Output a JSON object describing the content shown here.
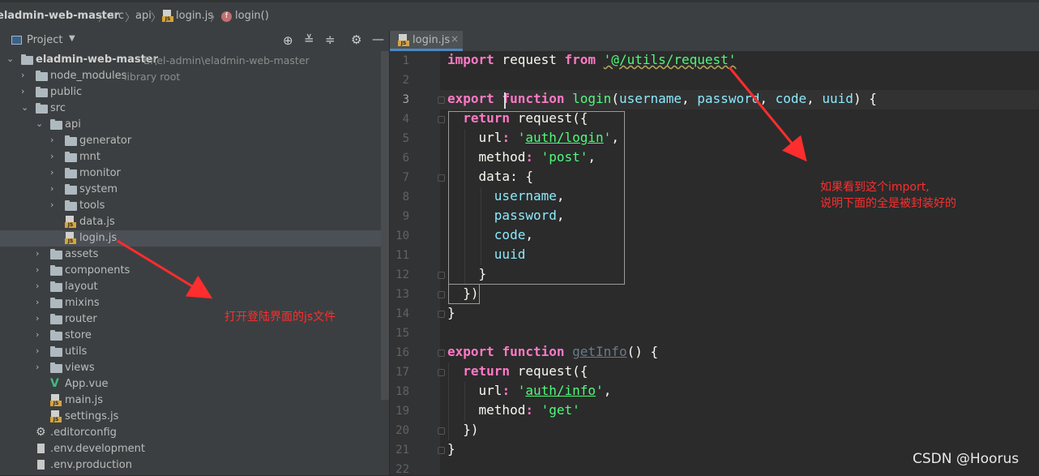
{
  "breadcrumb": {
    "project": "eladmin-web-master",
    "src": "src",
    "api": "api",
    "file": "login.js",
    "func": "login()",
    "func_badge": "f"
  },
  "project_panel": {
    "title": "Project",
    "root": {
      "name": "eladmin-web-master",
      "path": "E:\\el-admin\\eladmin-web-master"
    },
    "items": [
      {
        "label": "node_modules",
        "hint": "library root"
      },
      {
        "label": "public"
      },
      {
        "label": "src"
      },
      {
        "label": "api"
      },
      {
        "label": "generator"
      },
      {
        "label": "mnt"
      },
      {
        "label": "monitor"
      },
      {
        "label": "system"
      },
      {
        "label": "tools"
      },
      {
        "label": "data.js"
      },
      {
        "label": "login.js"
      },
      {
        "label": "assets"
      },
      {
        "label": "components"
      },
      {
        "label": "layout"
      },
      {
        "label": "mixins"
      },
      {
        "label": "router"
      },
      {
        "label": "store"
      },
      {
        "label": "utils"
      },
      {
        "label": "views"
      },
      {
        "label": "App.vue"
      },
      {
        "label": "main.js"
      },
      {
        "label": "settings.js"
      },
      {
        "label": ".editorconfig"
      },
      {
        "label": ".env.development"
      },
      {
        "label": ".env.production"
      }
    ]
  },
  "editor": {
    "tab_label": "login.js",
    "tab_close": "×",
    "line_numbers": [
      "1",
      "2",
      "3",
      "4",
      "5",
      "6",
      "7",
      "8",
      "9",
      "10",
      "11",
      "12",
      "13",
      "14",
      "15",
      "16",
      "17",
      "18",
      "19",
      "20",
      "21",
      "22"
    ],
    "code": {
      "l1_import": "import",
      "l1_request": " request ",
      "l1_from": "from",
      "l1_str": "'@/utils/request'",
      "l3_export": "export",
      "l3_function": "function",
      "l3_name": "login",
      "l3_open": "(",
      "l3_p1": "username",
      "l3_c1": ", ",
      "l3_p2": "password",
      "l3_c2": ", ",
      "l3_p3": "code",
      "l3_c3": ", ",
      "l3_p4": "uuid",
      "l3_close": ") {",
      "l4_return": "return",
      "l4_rest": " request({",
      "l5_key": "url",
      "l5_colon": ": ",
      "l5_q1": "'",
      "l5_val": "auth/login",
      "l5_q2": "'",
      "l5_end": ",",
      "l6_key": "method",
      "l6_colon": ": ",
      "l6_val": "'post'",
      "l6_end": ",",
      "l7_key": "data",
      "l7_rest": ": {",
      "l8": "username",
      "l8_end": ",",
      "l9": "password",
      "l9_end": ",",
      "l10": "code",
      "l10_end": ",",
      "l11": "uuid",
      "l12": "}",
      "l13": "})",
      "l14": "}",
      "l16_export": "export",
      "l16_function": "function",
      "l16_name": "getInfo",
      "l16_rest": "() {",
      "l17_return": "return",
      "l17_rest": " request({",
      "l18_key": "url",
      "l18_colon": ": ",
      "l18_q1": "'",
      "l18_val": "auth/info",
      "l18_q2": "'",
      "l18_end": ",",
      "l19_key": "method",
      "l19_colon": ": ",
      "l19_val": "'get'",
      "l20": "})",
      "l21": "}"
    }
  },
  "annotations": {
    "left": "打开登陆界面的js文件",
    "right_line1": "如果看到这个import,",
    "right_line2": "说明下面的全是被封装好的"
  },
  "watermark": "CSDN @Hoorus",
  "colors": {
    "annotation": "#ff2d2d",
    "keyword": "#ff79c6",
    "string": "#50fa7b",
    "param": "#8be9fd"
  }
}
